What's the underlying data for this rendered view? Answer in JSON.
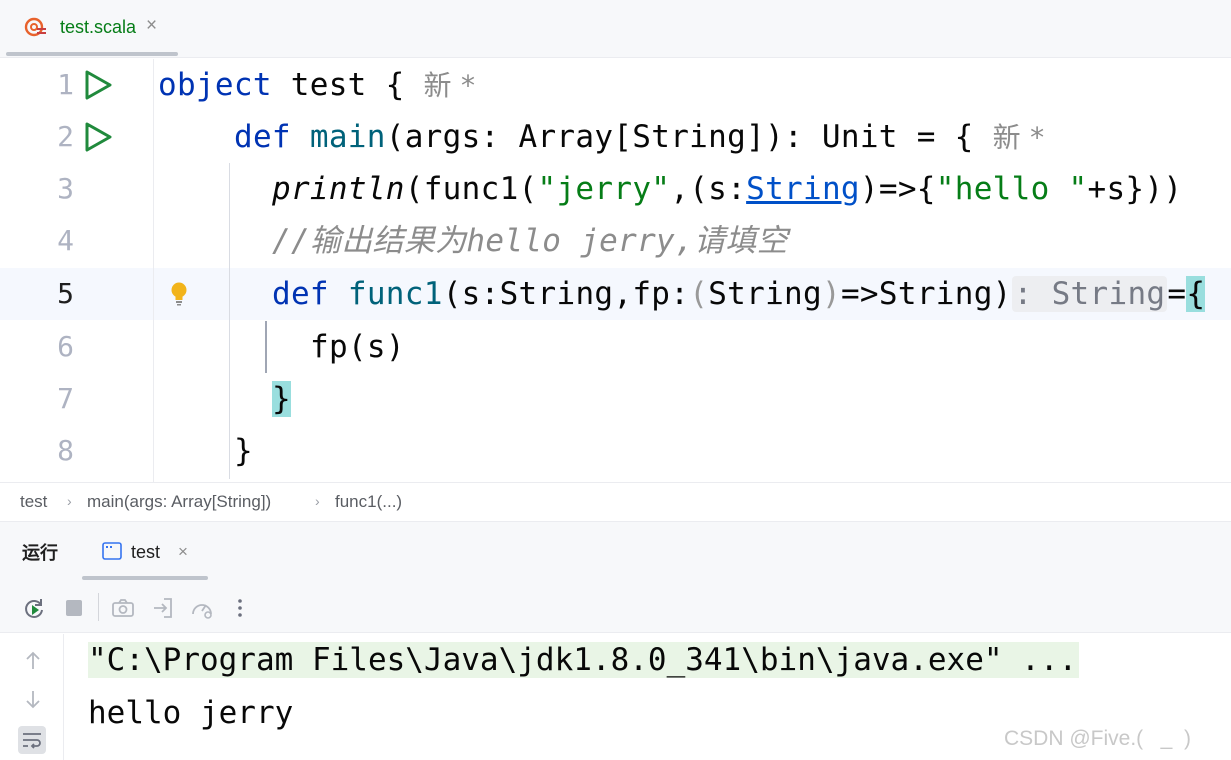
{
  "editor_tab": {
    "filename": "test.scala",
    "close": "×"
  },
  "code": {
    "line_numbers": [
      "1",
      "2",
      "3",
      "4",
      "5",
      "6",
      "7",
      "8"
    ],
    "line1": {
      "kw": "object",
      "name": " test ",
      "brace": "{",
      "hint": "新 *"
    },
    "line2": {
      "kw": "def",
      "fn": "main",
      "sig": "(args: Array[String]): Unit = ",
      "brace": "{",
      "hint": "新 *"
    },
    "line3": {
      "call": "println",
      "a": "(func1(",
      "s1": "\"jerry\"",
      "b": ",(s:",
      "type": "String",
      "c": ")=>{",
      "s2": "\"hello \"",
      "d": "+s}))"
    },
    "line4": {
      "comment": "//输出结果为hello jerry,请填空"
    },
    "line5": {
      "kw": "def",
      "fn": "func1",
      "a": "(s:String,fp:",
      "p1": "(",
      "b": "String",
      "p2": ")",
      "c": "=>String)",
      "inlay": ": String",
      "d": "=",
      "brace": "{"
    },
    "line6": {
      "text": "fp(s)"
    },
    "line7": {
      "brace": "}"
    },
    "line8": {
      "brace": "}"
    }
  },
  "breadcrumbs": [
    "test",
    "main(args: Array[String])",
    "func1(...)"
  ],
  "run_panel": {
    "title": "运行",
    "tab_label": "test",
    "close": "×"
  },
  "console": {
    "lines": [
      "\"C:\\Program Files\\Java\\jdk1.8.0_341\\bin\\java.exe\" ...",
      "hello jerry"
    ]
  },
  "watermark": "CSDN @Five.(   _  )",
  "colors": {
    "keyword": "#0033b3",
    "function": "#00627a",
    "string": "#067d17",
    "comment": "#8c8c8c",
    "run_green": "#208a3c"
  }
}
